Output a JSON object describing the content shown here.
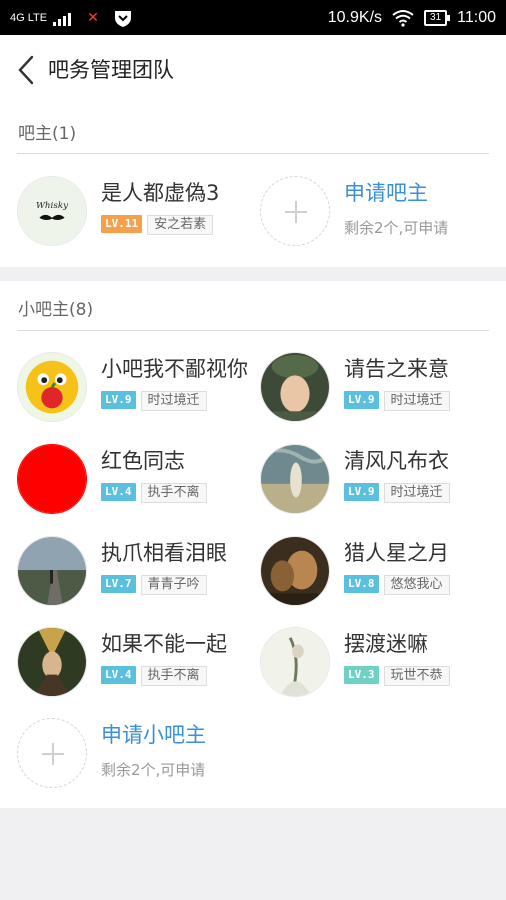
{
  "status_bar": {
    "network": "4G LTE",
    "speed": "10.9K/s",
    "battery": "31",
    "time": "11:00"
  },
  "header": {
    "title": "吧务管理团队"
  },
  "owners": {
    "title": "吧主(1)",
    "members": [
      {
        "name": "是人都虚偽3",
        "level": "LV.11",
        "level_color": "#f5a04a",
        "tag": "安之若素"
      }
    ],
    "apply": {
      "title": "申请吧主",
      "subtitle": "剩余2个,可申请"
    }
  },
  "sub_owners": {
    "title": "小吧主(8)",
    "members": [
      {
        "name": "小吧我不鄙视你",
        "level": "LV.9",
        "level_color": "#5bc0de",
        "tag": "时过境迁"
      },
      {
        "name": "请告之来意",
        "level": "LV.9",
        "level_color": "#5bc0de",
        "tag": "时过境迁"
      },
      {
        "name": "红色同志",
        "level": "LV.4",
        "level_color": "#5bc0de",
        "tag": "执手不离"
      },
      {
        "name": "清风凡布衣",
        "level": "LV.9",
        "level_color": "#5bc0de",
        "tag": "时过境迁"
      },
      {
        "name": "执爪相看泪眼",
        "level": "LV.7",
        "level_color": "#5bc0de",
        "tag": "青青子吟"
      },
      {
        "name": "猎人星之月",
        "level": "LV.8",
        "level_color": "#5bc0de",
        "tag": "悠悠我心"
      },
      {
        "name": "如果不能一起",
        "level": "LV.4",
        "level_color": "#5bc0de",
        "tag": "执手不离"
      },
      {
        "name": "摆渡迷嘛",
        "level": "LV.3",
        "level_color": "#6fd0c4",
        "tag": "玩世不恭"
      }
    ],
    "apply": {
      "title": "申请小吧主",
      "subtitle": "剩余2个,可申请"
    }
  }
}
